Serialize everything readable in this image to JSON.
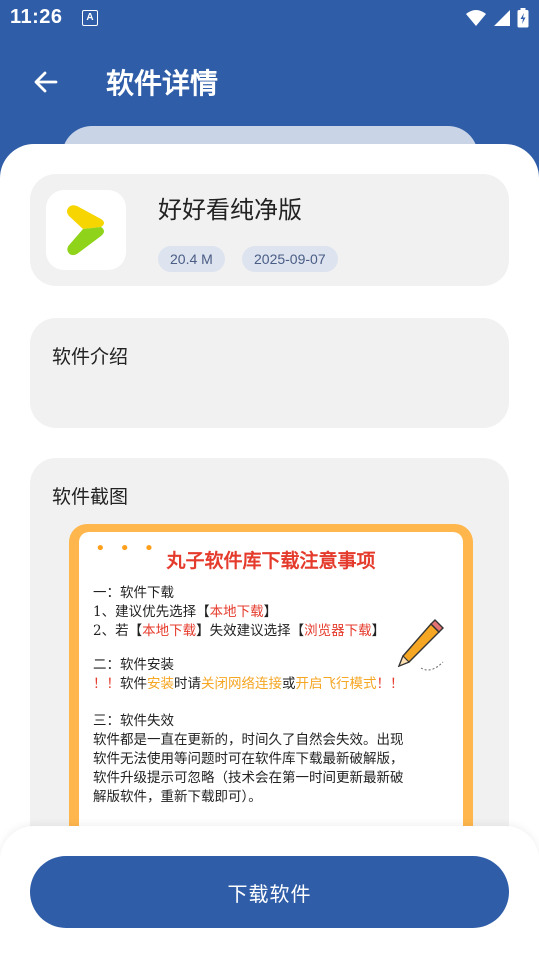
{
  "status_bar": {
    "time": "11:26",
    "notification_glyph": "A"
  },
  "header": {
    "title": "软件详情"
  },
  "app": {
    "name": "好好看纯净版",
    "size": "20.4 M",
    "date": "2025-09-07"
  },
  "intro": {
    "heading": "软件介绍"
  },
  "screenshots": {
    "heading": "软件截图",
    "poster": {
      "title": "丸子软件库下载注意事项",
      "dots": "• • •",
      "s1_title": "一：软件下载",
      "s1_l1_a": "1、建议优先选择【",
      "s1_l1_b": "本地下载",
      "s1_l1_c": "】",
      "s1_l2_a": "2、若【",
      "s1_l2_b": "本地下载",
      "s1_l2_c": "】失效建议选择【",
      "s1_l2_d": "浏览器下载",
      "s1_l2_e": "】",
      "s2_title": "二：软件安装",
      "s2_l1_a": "！！",
      "s2_l1_b": "软件",
      "s2_l1_c": "安装",
      "s2_l1_d": "时请",
      "s2_l1_e": "关闭网络连接",
      "s2_l1_f": "或",
      "s2_l1_g": "开启飞行模式",
      "s2_l1_h": "！！",
      "s3_title": "三：软件失效",
      "s3_l1": "软件都是一直在更新的，时间久了自然会失效。出现",
      "s3_l2": "软件无法使用等问题时可在软件库下载最新破解版，",
      "s3_l3": "软件升级提示可忽略（技术会在第一时间更新最新破",
      "s3_l4": "解版软件，重新下载即可）。"
    }
  },
  "actions": {
    "download": "下载软件"
  },
  "colors": {
    "primary": "#2f5da8",
    "accent_red": "#e53b2c",
    "accent_orange": "#f5a623",
    "poster_frame": "#ffb74d"
  },
  "icons": [
    "back-arrow-icon",
    "wifi-icon",
    "signal-icon",
    "battery-icon",
    "app-logo-icon",
    "pencil-icon"
  ]
}
